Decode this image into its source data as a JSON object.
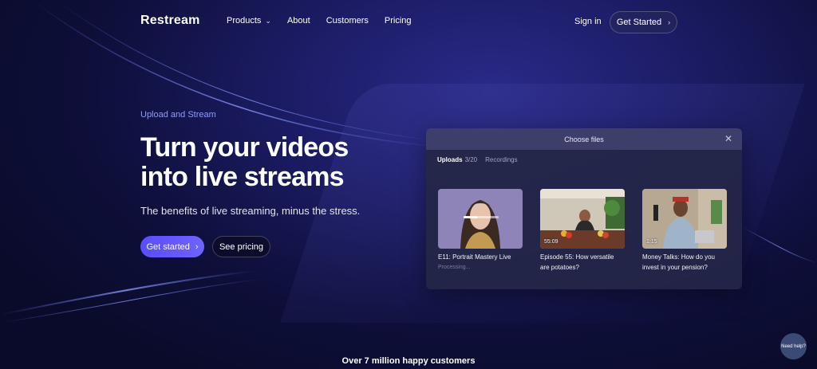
{
  "nav": {
    "logo": "Restream",
    "items": [
      {
        "label": "Products",
        "dropdown": true
      },
      {
        "label": "About"
      },
      {
        "label": "Customers"
      },
      {
        "label": "Pricing"
      }
    ],
    "sign_in": "Sign in",
    "get_started": "Get Started"
  },
  "hero": {
    "eyebrow": "Upload and Stream",
    "title_line1": "Turn your videos",
    "title_line2": "into live streams",
    "subtitle": "The benefits of live streaming, minus the stress.",
    "primary_button": "Get started",
    "secondary_button": "See pricing"
  },
  "modal": {
    "title": "Choose files",
    "tab_uploads": "Uploads",
    "uploads_count": "3/20",
    "tab_recordings": "Recordings",
    "cards": [
      {
        "title": "E11: Portrait Mastery Live",
        "status": "Processing...",
        "progress": 0.4
      },
      {
        "title": "Episode 55: How versatile are potatoes?",
        "duration": "55:09"
      },
      {
        "title": "Money Talks: How do you invest in your pension?",
        "duration": "1:15"
      }
    ]
  },
  "footer": {
    "customers": "Over 7 million happy customers",
    "help": "Need help?"
  },
  "colors": {
    "accent": "#5a4dff",
    "eyebrow": "#8e9cff",
    "background": "#1c1c66"
  }
}
